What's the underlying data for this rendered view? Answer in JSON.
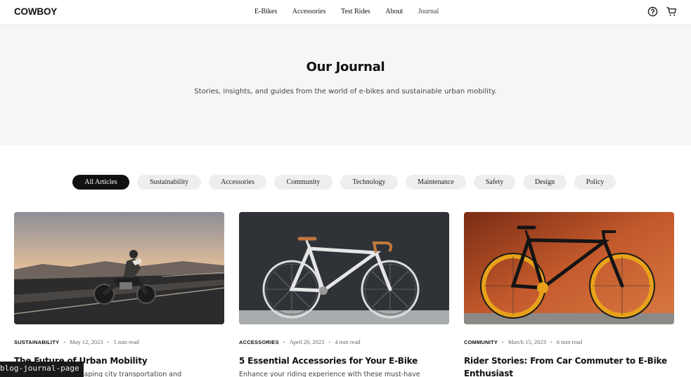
{
  "brand": "COWBOY",
  "nav": {
    "items": [
      "E-Bikes",
      "Accessories",
      "Test Rides",
      "About",
      "Journal"
    ],
    "icons": [
      "help-icon",
      "cart-icon"
    ]
  },
  "hero": {
    "title": "Our Journal",
    "subtitle": "Stories, insights, and guides from the world of e-bikes and sustainable urban mobility."
  },
  "filters": {
    "active": "All Articles",
    "items": [
      "All Articles",
      "Sustainability",
      "Accessories",
      "Community",
      "Technology",
      "Maintenance",
      "Safety",
      "Design",
      "Policy"
    ]
  },
  "articles": [
    {
      "category": "SUSTAINABILITY",
      "date": "May 12, 2023",
      "read_time": "5 min read",
      "title": "The Future of Urban Mobility",
      "excerpt": "How e-bikes are reshaping city transportation and"
    },
    {
      "category": "ACCESSORIES",
      "date": "April 28, 2023",
      "read_time": "4 min read",
      "title": "5 Essential Accessories for Your E-Bike",
      "excerpt": "Enhance your riding experience with these must-have"
    },
    {
      "category": "COMMUNITY",
      "date": "March 15, 2023",
      "read_time": "6 min read",
      "title": "Rider Stories: From Car Commuter to E-Bike Enthusiast",
      "excerpt": ""
    }
  ],
  "page_tag": "blog-journal-page"
}
